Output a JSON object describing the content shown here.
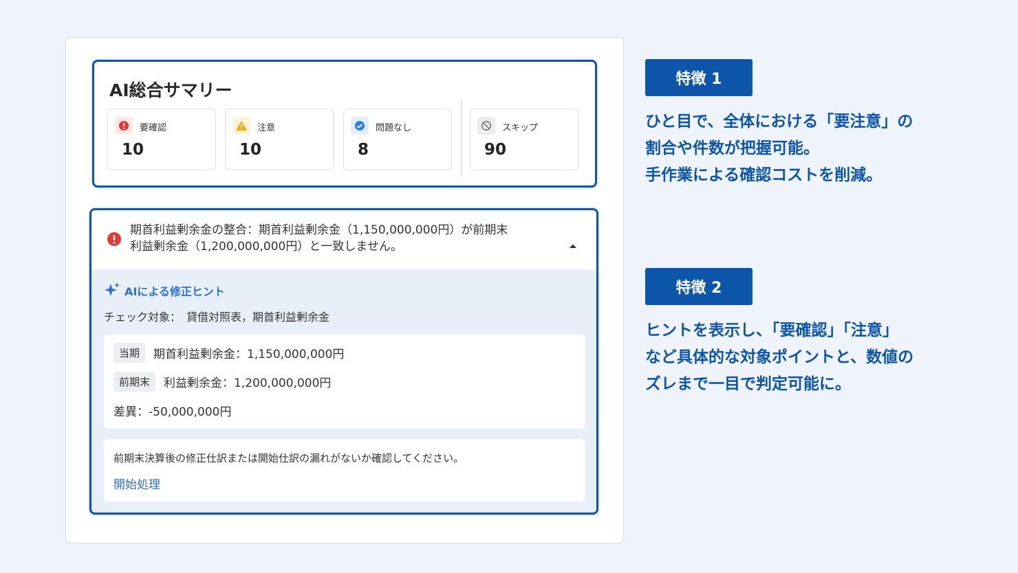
{
  "summary": {
    "title": "AI総合サマリー",
    "stats": [
      {
        "label": "要確認",
        "value": "10",
        "icon": "error-icon",
        "color": "#e53935"
      },
      {
        "label": "注意",
        "value": "10",
        "icon": "warning-icon",
        "color": "#f2a900"
      },
      {
        "label": "問題なし",
        "value": "8",
        "icon": "check-circle-icon",
        "color": "#2b7de9"
      },
      {
        "label": "スキップ",
        "value": "90",
        "icon": "block-icon",
        "color": "#777777"
      }
    ]
  },
  "issue": {
    "message_line1": "期首利益剰余金の整合：期首利益剰余金（1,150,000,000円）が前期末",
    "message_line2": "利益剰余金（1,200,000,000円）と一致しません。",
    "hint_title": "AIによる修正ヒント",
    "check_target": "チェック対象：　貸借対照表，期首利益剰余金",
    "current_tag": "当期",
    "current_value": "期首利益剰余金：1,150,000,000円",
    "prev_tag": "前期末",
    "prev_value": "利益剰余金：1,200,000,000円",
    "difference": "差異：-50,000,000円",
    "note": "前期末決算後の修正仕訳または開始仕訳の漏れがないか確認してください。",
    "link": "開始処理"
  },
  "features": [
    {
      "badge": "特徴 1",
      "lines": [
        "ひと目で、全体における「要注意」の",
        "割合や件数が把握可能。",
        "手作業による確認コストを削減。"
      ]
    },
    {
      "badge": "特徴 2",
      "lines": [
        "ヒントを表示し、「要確認」「注意」",
        "など具体的な対象ポイントと、数値の",
        "ズレまで一目で判定可能に。"
      ]
    }
  ],
  "colors": {
    "accent": "#0d55a8",
    "link": "#2f6fd0",
    "background": "#eff3fb"
  }
}
